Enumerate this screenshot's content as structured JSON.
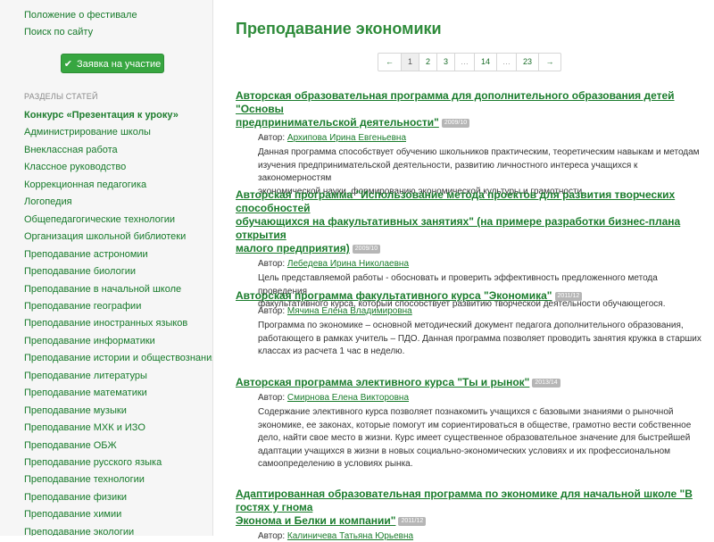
{
  "sidebar": {
    "top_links": [
      "Положение о фестивале",
      "Поиск по сайту"
    ],
    "apply_button": "Заявка на участие",
    "sections_title": "РАЗДЕЛЫ СТАТЕЙ",
    "sections": [
      "Конкурс «Презентация к уроку»",
      "Администрирование школы",
      "Внеклассная работа",
      "Классное руководство",
      "Коррекционная педагогика",
      "Логопедия",
      "Общепедагогические технологии",
      "Организация школьной библиотеки",
      "Преподавание астрономии",
      "Преподавание биологии",
      "Преподавание в начальной школе",
      "Преподавание географии",
      "Преподавание иностранных языков",
      "Преподавание информатики",
      "Преподавание истории и обществознания",
      "Преподавание литературы",
      "Преподавание математики",
      "Преподавание музыки",
      "Преподавание МХК и ИЗО",
      "Преподавание ОБЖ",
      "Преподавание русского языка",
      "Преподавание технологии",
      "Преподавание физики",
      "Преподавание химии",
      "Преподавание экологии"
    ]
  },
  "main": {
    "title": "Преподавание экономики",
    "pagination": {
      "prev": "←",
      "pages": [
        "1",
        "2",
        "3",
        "…",
        "14",
        "…",
        "23"
      ],
      "next": "→",
      "current": "1"
    },
    "author_label": "Автор:",
    "articles": [
      {
        "title_lines": [
          "Авторская образовательная программа для дополнительного образования детей \"Основы",
          "предпринимательской деятельности\""
        ],
        "badge": "2009/10",
        "author": "Архипова Ирина Евгеньевна",
        "desc_lines": [
          "Данная программа способствует обучению школьников практическим, теоретическим навыкам и методам",
          "изучения предпринимательской деятельности, развитию личностного интереса учащихся к закономерностям",
          "экономической науки, формированию экономической культуры и грамотности."
        ]
      },
      {
        "title_lines": [
          "Авторская программа \"Использование метода проектов для развития творческих способностей",
          "обучающихся на факультативных занятиях\" (на примере разработки бизнес-плана открытия",
          "малого предприятия)"
        ],
        "badge": "2009/10",
        "author": "Лебедева Ирина Николаевна",
        "desc_lines": [
          "Цель представляемой работы - обосновать и проверить эффективность предложенного метода проведения",
          "факультативного курса, который способствует развитию творческой деятельности обучающегося."
        ]
      },
      {
        "title_lines": [
          "Авторская программа факультативного курса \"Экономика\""
        ],
        "badge": "2011/12",
        "author": "Мячина Елена Владимировна",
        "desc_lines": [
          "Программа по экономике – основной методический документ педагога дополнительного образования,",
          "работающего в рамках учитель – ПДО. Данная программа позволяет проводить занятия кружка в старших",
          "классах из расчета 1 час в неделю."
        ]
      },
      {
        "title_lines": [
          "Авторская программа элективного курса \"Ты и рынок\""
        ],
        "badge": "2013/14",
        "author": "Смирнова Елена Викторовна",
        "desc_lines": [
          "Содержание элективного курса позволяет познакомить учащихся с базовыми знаниями о рыночной",
          "экономике, ее законах, которые помогут им сориентироваться в обществе, грамотно вести собственное",
          "дело, найти свое место в жизни. Курс имеет существенное образовательное значение для быстрейшей",
          "адаптации учащихся в жизни в новых социально-экономических условиях и их профессиональном",
          "самоопределению в условиях рынка."
        ]
      },
      {
        "title_lines": [
          "Адаптированная образовательная программа по экономике для начальной школе \"В гостях у гнома",
          "Эконома и Белки и компании\""
        ],
        "badge": "2011/12",
        "author": "Калиничева Татьяна Юрьевна",
        "desc_lines": []
      }
    ]
  },
  "colors": {
    "link_green": "#1a7c2c",
    "title_green": "#2e8b3a",
    "button_green": "#37a640",
    "sidebar_bg": "#f6f6f6",
    "badge_gray": "#b6b6b6"
  }
}
